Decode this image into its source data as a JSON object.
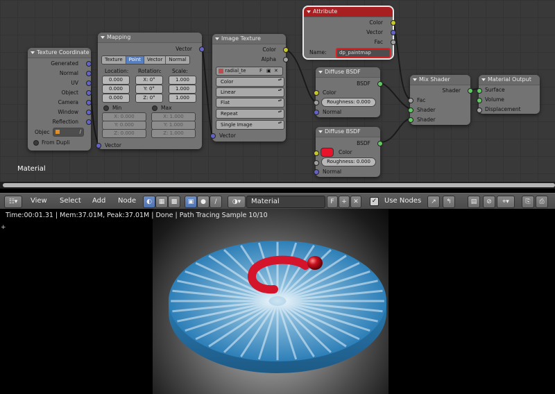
{
  "nodes": {
    "texture_coordinate": {
      "title": "Texture Coordinate",
      "outputs": [
        "Generated",
        "Normal",
        "UV",
        "Object",
        "Camera",
        "Window",
        "Reflection"
      ],
      "object_label": "Objec",
      "from_dupli": "From Dupli"
    },
    "mapping": {
      "title": "Mapping",
      "output": "Vector",
      "modes": [
        "Texture",
        "Point",
        "Vector",
        "Normal"
      ],
      "active_mode": "Point",
      "location_label": "Location:",
      "rotation_label": "Rotation:",
      "scale_label": "Scale:",
      "location": [
        "0.000",
        "0.000",
        "0.000"
      ],
      "rotation": [
        "X:   0°",
        "Y:   0°",
        "Z:   0°"
      ],
      "scale": [
        "1.000",
        "1.000",
        "1.000"
      ],
      "min_label": "Min",
      "max_label": "Max",
      "min": [
        "X:     0.000",
        "Y:     0.000",
        "Z:     0.000"
      ],
      "max": [
        "X:     1.000",
        "Y:     1.000",
        "Z:     1.000"
      ],
      "input": "Vector"
    },
    "image_texture": {
      "title": "Image Texture",
      "outputs": [
        "Color",
        "Alpha"
      ],
      "image_name": "radial_te",
      "image_f": "F",
      "dropdowns": [
        "Color",
        "Linear",
        "Flat",
        "Repeat",
        "Single Image"
      ],
      "input": "Vector"
    },
    "attribute": {
      "title": "Attribute",
      "outputs": [
        "Color",
        "Vector",
        "Fac"
      ],
      "name_label": "Name:",
      "name_value": "dp_paintmap"
    },
    "diffuse_1": {
      "title": "Diffuse BSDF",
      "output": "BSDF",
      "color_label": "Color",
      "roughness": "Roughness: 0.000",
      "normal_label": "Normal"
    },
    "diffuse_2": {
      "title": "Diffuse BSDF",
      "output": "BSDF",
      "color_label": "Color",
      "color_value": "#e8142c",
      "roughness": "Roughness: 0.000",
      "normal_label": "Normal"
    },
    "mix_shader": {
      "title": "Mix Shader",
      "output": "Shader",
      "inputs": [
        "Fac",
        "Shader",
        "Shader"
      ]
    },
    "material_output": {
      "title": "Material Output",
      "inputs": [
        "Surface",
        "Volume",
        "Displacement"
      ]
    }
  },
  "editor_label": "Material",
  "header": {
    "menus": [
      "View",
      "Select",
      "Add",
      "Node"
    ],
    "material_name": "Material",
    "fake_user": "F",
    "use_nodes_label": "Use Nodes"
  },
  "viewport": {
    "status": "Time:00:01.31 | Mem:37.01M, Peak:37.01M | Done | Path Tracing Sample 10/10"
  },
  "colors": {
    "socket_color": "#c7c729",
    "socket_vector": "#6363c7",
    "socket_shader": "#63c763",
    "active_blue": "#5680c2",
    "attribute_header": "#a81f22",
    "disc_blue": "#2d7fb8",
    "paint_red": "#d4142a"
  }
}
